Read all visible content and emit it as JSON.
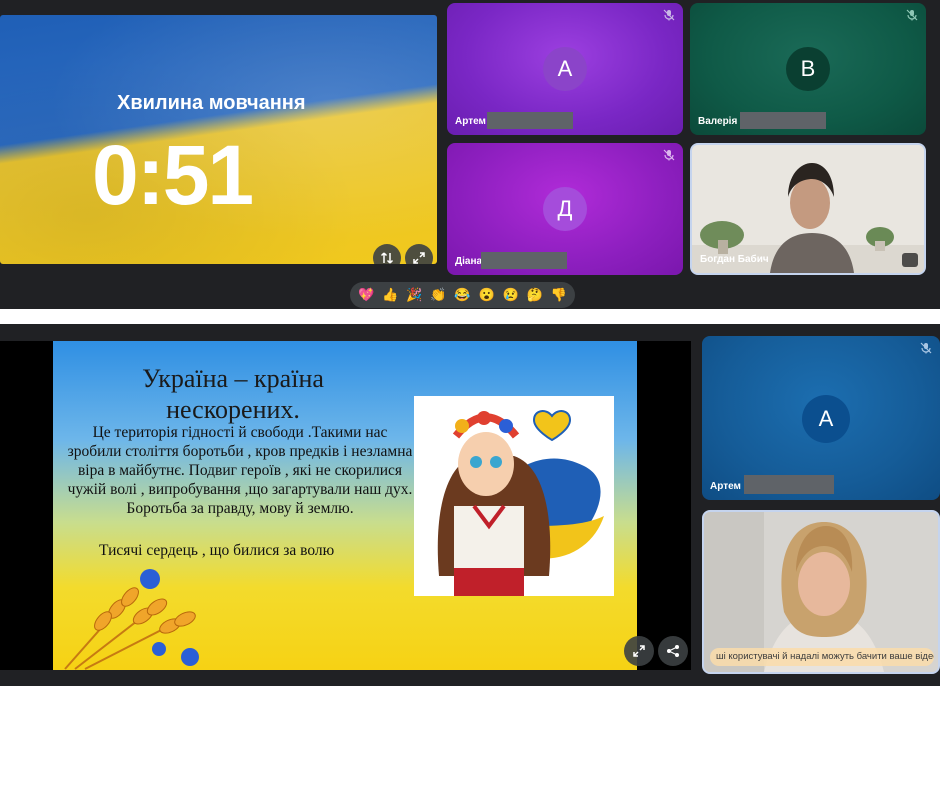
{
  "top": {
    "presentation": {
      "title": "Хвилина мовчання",
      "timer": "0:51"
    },
    "tiles": [
      {
        "initial": "А",
        "name": "Артем"
      },
      {
        "initial": "В",
        "name": "Валерія"
      },
      {
        "initial": "Д",
        "name": "Діана"
      },
      {
        "name": "Богдан Бабич"
      }
    ],
    "reactions": [
      "💖",
      "👍",
      "🎉",
      "👏",
      "😂",
      "😮",
      "😢",
      "🤔",
      "👎"
    ]
  },
  "bottom": {
    "slide": {
      "title": "Україна – країна нескорених.",
      "body": "Це територія гідності й свободи .Такими нас зробили століття боротьби , кров предків і незламна віра в майбутнє. Подвиг героїв , які не скорилися чужій волі , випробування ,що загартували наш дух. Боротьба за правду, мову й землю.",
      "footer": "Тисячі сердець , що билися за волю"
    },
    "tiles": [
      {
        "initial": "А",
        "name": "Артем"
      },
      {
        "caption": "ші користувачі й надалі можуть бачити ваше відео повн"
      }
    ]
  },
  "colors": {
    "meet_bg": "#202124",
    "flag_blue": "#1f5fb6",
    "flag_yellow": "#f1c91c"
  }
}
